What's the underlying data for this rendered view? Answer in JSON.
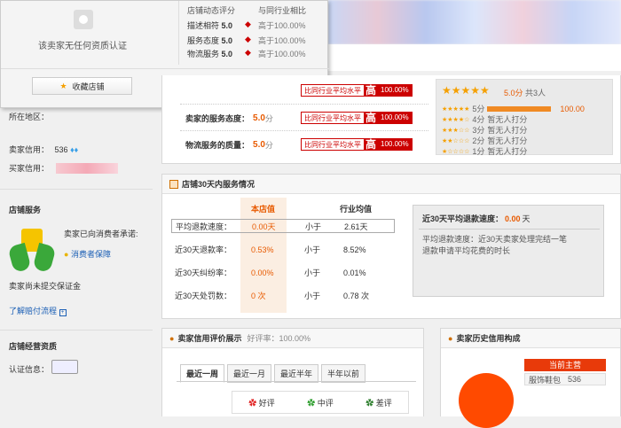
{
  "popup": {
    "no_cert_text": "该卖家无任何资质认证",
    "dsr_header": "店铺动态评分",
    "compare_header": "与同行业相比",
    "rows": [
      {
        "label": "描述相符",
        "score": "5.0",
        "compare": "高于100.00%"
      },
      {
        "label": "服务态度",
        "score": "5.0",
        "compare": "高于100.00%"
      },
      {
        "label": "物流服务",
        "score": "5.0",
        "compare": "高于100.00%"
      }
    ],
    "favorite_button": "收藏店铺"
  },
  "left": {
    "location_label": "所在地区：",
    "seller_credit_label": "卖家信用：",
    "seller_credit_value": "536",
    "buyer_credit_label": "买家信用：",
    "shop_service_title": "店铺服务",
    "promise_text": "卖家已向消费者承诺:",
    "consumer_guarantee": "消费者保障",
    "no_deposit_text": "卖家尚未提交保证金",
    "process_link": "了解赔付流程",
    "qualification_title": "店铺经营资质",
    "cert_label": "认证信息："
  },
  "ratings": {
    "compare_label": "比同行业平均水平",
    "gao": "高",
    "percent": "100.00%",
    "service_label": "卖家的服务态度：",
    "service_score": "5.0",
    "logistics_label": "物流服务的质量：",
    "logistics_score": "5.0",
    "unit": "分",
    "summary_score": "5.0分",
    "summary_count": "共3人",
    "dist": [
      {
        "label": "5分",
        "value": "100.00"
      },
      {
        "label": "4分",
        "value": "暂无人打分"
      },
      {
        "label": "3分",
        "value": "暂无人打分"
      },
      {
        "label": "2分",
        "value": "暂无人打分"
      },
      {
        "label": "1分",
        "value": "暂无人打分"
      }
    ]
  },
  "service30": {
    "title": "店铺30天内服务情况",
    "col_shop": "本店值",
    "col_avg": "行业均值",
    "rows": [
      {
        "label": "平均退款速度：",
        "shop": "0.00天",
        "cmp": "小于",
        "avg": "2.61天"
      },
      {
        "label": "近30天退款率：",
        "shop": "0.53%",
        "cmp": "小于",
        "avg": "8.52%"
      },
      {
        "label": "近30天纠纷率：",
        "shop": "0.00%",
        "cmp": "小于",
        "avg": "0.01%"
      },
      {
        "label": "近30天处罚数：",
        "shop": "0 次",
        "cmp": "小于",
        "avg": "0.78 次"
      }
    ],
    "side_title": "近30天平均退款速度：",
    "side_value": "0.00",
    "side_unit": "天",
    "side_desc": "平均退款速度：近30天卖家处理完结一笔退款申请平均花费的时长"
  },
  "credit": {
    "title": "卖家信用评价展示",
    "good_rate_label": "好评率：",
    "good_rate": "100.00%",
    "tabs": [
      "最近一周",
      "最近一月",
      "最近半年",
      "半年以前"
    ],
    "cols": [
      "好评",
      "中评",
      "差评"
    ]
  },
  "history": {
    "title": "卖家历史信用构成",
    "main_label": "当前主营",
    "category": "服饰鞋包",
    "count": "536"
  },
  "colors": {
    "accent": "#e85a00",
    "red": "#cc0000",
    "star": "#f5a000"
  }
}
